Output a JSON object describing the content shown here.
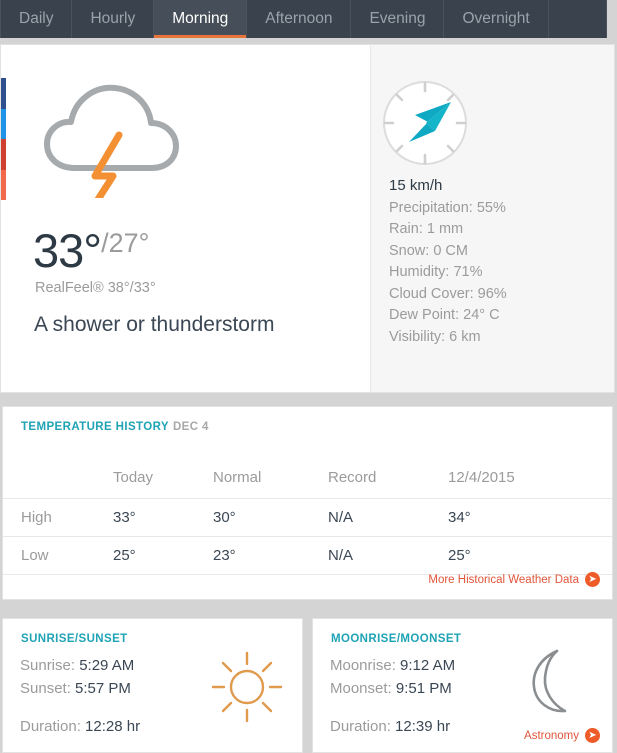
{
  "tabs": [
    {
      "label": "Daily",
      "active": false
    },
    {
      "label": "Hourly",
      "active": false
    },
    {
      "label": "Morning",
      "active": true
    },
    {
      "label": "Afternoon",
      "active": false
    },
    {
      "label": "Evening",
      "active": false
    },
    {
      "label": "Overnight",
      "active": false
    }
  ],
  "current": {
    "icon": "thunderstorm-cloud-icon",
    "temp_high": "33°",
    "temp_low": "/27°",
    "realfeel": "RealFeel® 38°/33°",
    "phrase": "A shower or thunderstorm",
    "color_strip": [
      "#2f4f8f",
      "#1e93e8",
      "#cf4030",
      "#f26a4b"
    ]
  },
  "details": {
    "wind": "15 km/h",
    "compass_icon": "wind-direction-arrow-icon",
    "items": [
      "Precipitation: 55%",
      "Rain: 1 mm",
      "Snow: 0 CM",
      "Humidity: 71%",
      "Cloud Cover: 96%",
      "Dew Point: 24° C",
      "Visibility: 6 km"
    ]
  },
  "history": {
    "title": "TEMPERATURE HISTORY",
    "subtitle": "DEC 4",
    "columns": [
      "",
      "Today",
      "Normal",
      "Record",
      "12/4/2015"
    ],
    "rows": [
      {
        "label": "High",
        "today": "33°",
        "normal": "30°",
        "record": "N/A",
        "past": "34°"
      },
      {
        "label": "Low",
        "today": "25°",
        "normal": "23°",
        "record": "N/A",
        "past": "25°"
      }
    ],
    "link_label": "More Historical Weather Data"
  },
  "sun": {
    "title": "SUNRISE/SUNSET",
    "rise_label": "Sunrise:",
    "rise_value": "5:29 AM",
    "set_label": "Sunset:",
    "set_value": "5:57 PM",
    "duration_label": "Duration:",
    "duration_value": "12:28 hr",
    "icon": "sun-icon"
  },
  "moon": {
    "title": "MOONRISE/MOONSET",
    "rise_label": "Moonrise:",
    "rise_value": "9:12 AM",
    "set_label": "Moonset:",
    "set_value": "9:51 PM",
    "duration_label": "Duration:",
    "duration_value": "12:39 hr",
    "icon": "moon-crescent-icon",
    "link_label": "Astronomy"
  },
  "colors": {
    "accent_orange": "#ee5b29",
    "accent_teal": "#1fa3b5",
    "tabbar_bg": "#3a434d",
    "text_dark": "#3b4754",
    "text_muted": "#9b9b9b"
  }
}
